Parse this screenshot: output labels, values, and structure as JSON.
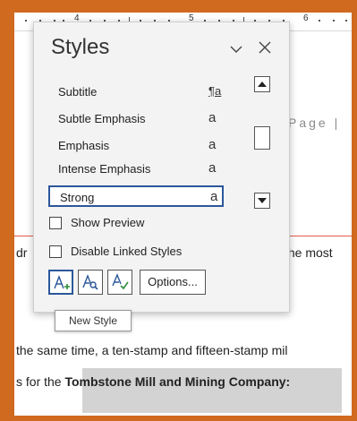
{
  "ruler": {
    "numbers": [
      "4",
      "5",
      "6"
    ]
  },
  "document": {
    "page_label": "Page |",
    "line1_start": "dr",
    "line1_end": "the most",
    "line3": "the same time, a ten-stamp and fifteen-stamp mil",
    "line4_prefix": "s for the ",
    "line4_bold": "Tombstone Mill and Mining Company:"
  },
  "styles_pane": {
    "title": "Styles",
    "items": [
      {
        "name": "Subtitle",
        "mark": "¶a"
      },
      {
        "name": "Subtle Emphasis",
        "mark": "a"
      },
      {
        "name": "Emphasis",
        "mark": "a"
      },
      {
        "name": "Intense Emphasis",
        "mark": "a"
      },
      {
        "name": "Strong",
        "mark": "a",
        "selected": true
      }
    ],
    "show_preview_label": "Show Preview",
    "show_preview_checked": false,
    "disable_linked_label": "Disable Linked Styles",
    "disable_linked_checked": false,
    "options_label": "Options...",
    "icons": [
      "new-style-icon",
      "style-inspector-icon",
      "manage-styles-icon"
    ]
  },
  "tooltip": {
    "text": "New Style"
  },
  "colors": {
    "accent": "#2b579a",
    "window_border": "#d06a1e",
    "red_line": "#e25b4b"
  }
}
